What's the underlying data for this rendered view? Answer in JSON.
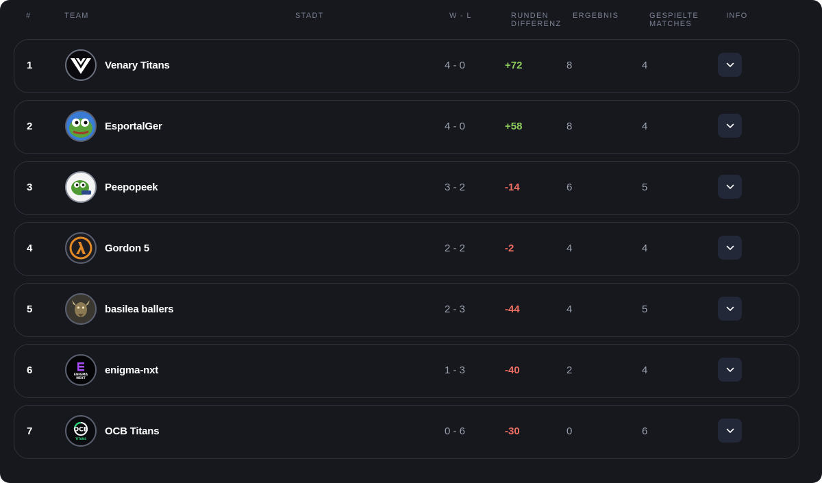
{
  "header": {
    "rank": "#",
    "team": "TEAM",
    "city": "STADT",
    "wl": "W - L",
    "diff_line1": "RUNDEN",
    "diff_line2": "DIFFERENZ",
    "result": "ERGEBNIS",
    "played_line1": "GESPIELTE",
    "played_line2": "MATCHES",
    "info": "INFO"
  },
  "colors": {
    "background": "#16181e",
    "row_border": "#2e323c",
    "positive": "#8fce5e",
    "negative": "#ef6f64",
    "button_bg": "#222838"
  },
  "teams": [
    {
      "rank": "1",
      "name": "Venary Titans",
      "logo": "venary-titans-logo",
      "wl": "4 - 0",
      "diff": "+72",
      "score": "8",
      "played": "4"
    },
    {
      "rank": "2",
      "name": "EsportalGer",
      "logo": "pepe-frog-logo",
      "wl": "4 - 0",
      "diff": "+58",
      "score": "8",
      "played": "4"
    },
    {
      "rank": "3",
      "name": "Peepopeek",
      "logo": "peepo-peek-logo",
      "wl": "3 - 2",
      "diff": "-14",
      "score": "6",
      "played": "5"
    },
    {
      "rank": "4",
      "name": "Gordon 5",
      "logo": "half-life-lambda-logo",
      "wl": "2 - 2",
      "diff": "-2",
      "score": "4",
      "played": "4"
    },
    {
      "rank": "5",
      "name": "basilea ballers",
      "logo": "basilisk-dragon-logo",
      "wl": "2 - 3",
      "diff": "-44",
      "score": "4",
      "played": "5"
    },
    {
      "rank": "6",
      "name": "enigma-nxt",
      "logo": "enigma-next-logo",
      "wl": "1 - 3",
      "diff": "-40",
      "score": "2",
      "played": "4"
    },
    {
      "rank": "7",
      "name": "OCB Titans",
      "logo": "ocb-titans-logo",
      "wl": "0 - 6",
      "diff": "-30",
      "score": "0",
      "played": "6"
    }
  ],
  "logo_text": {
    "enigma_line1": "ENIGMA",
    "enigma_line2": "NEXT",
    "ocb_line1": "OCB",
    "ocb_line2": "TITANS"
  }
}
